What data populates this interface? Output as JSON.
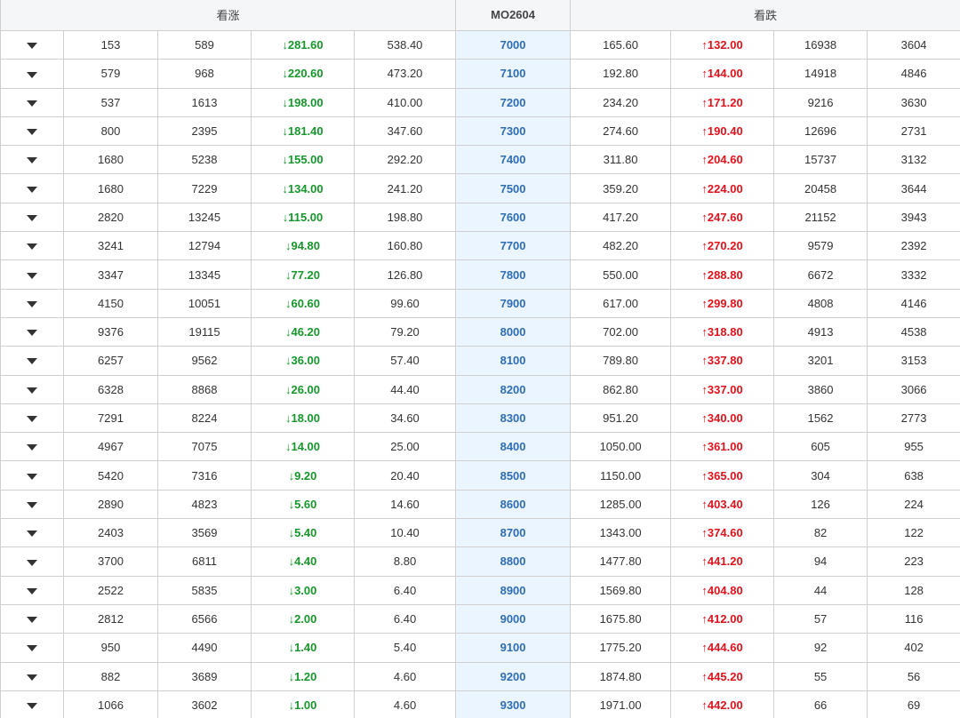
{
  "header": {
    "call_label": "看涨",
    "contract": "MO2604",
    "put_label": "看跌"
  },
  "colors": {
    "down": "#17962b",
    "up": "#e0121b",
    "strike": "#2e6db4",
    "strike_bg": "#ebf5ff"
  },
  "icons": {
    "expand": "caret-down-icon"
  },
  "rows": [
    {
      "call_oi": "153",
      "call_vol": "589",
      "call_chg": "↓281.60",
      "call_price": "538.40",
      "strike": "7000",
      "put_price": "165.60",
      "put_chg": "↑132.00",
      "put_vol": "16938",
      "put_oi": "3604"
    },
    {
      "call_oi": "579",
      "call_vol": "968",
      "call_chg": "↓220.60",
      "call_price": "473.20",
      "strike": "7100",
      "put_price": "192.80",
      "put_chg": "↑144.00",
      "put_vol": "14918",
      "put_oi": "4846"
    },
    {
      "call_oi": "537",
      "call_vol": "1613",
      "call_chg": "↓198.00",
      "call_price": "410.00",
      "strike": "7200",
      "put_price": "234.20",
      "put_chg": "↑171.20",
      "put_vol": "9216",
      "put_oi": "3630"
    },
    {
      "call_oi": "800",
      "call_vol": "2395",
      "call_chg": "↓181.40",
      "call_price": "347.60",
      "strike": "7300",
      "put_price": "274.60",
      "put_chg": "↑190.40",
      "put_vol": "12696",
      "put_oi": "2731"
    },
    {
      "call_oi": "1680",
      "call_vol": "5238",
      "call_chg": "↓155.00",
      "call_price": "292.20",
      "strike": "7400",
      "put_price": "311.80",
      "put_chg": "↑204.60",
      "put_vol": "15737",
      "put_oi": "3132"
    },
    {
      "call_oi": "1680",
      "call_vol": "7229",
      "call_chg": "↓134.00",
      "call_price": "241.20",
      "strike": "7500",
      "put_price": "359.20",
      "put_chg": "↑224.00",
      "put_vol": "20458",
      "put_oi": "3644"
    },
    {
      "call_oi": "2820",
      "call_vol": "13245",
      "call_chg": "↓115.00",
      "call_price": "198.80",
      "strike": "7600",
      "put_price": "417.20",
      "put_chg": "↑247.60",
      "put_vol": "21152",
      "put_oi": "3943"
    },
    {
      "call_oi": "3241",
      "call_vol": "12794",
      "call_chg": "↓94.80",
      "call_price": "160.80",
      "strike": "7700",
      "put_price": "482.20",
      "put_chg": "↑270.20",
      "put_vol": "9579",
      "put_oi": "2392"
    },
    {
      "call_oi": "3347",
      "call_vol": "13345",
      "call_chg": "↓77.20",
      "call_price": "126.80",
      "strike": "7800",
      "put_price": "550.00",
      "put_chg": "↑288.80",
      "put_vol": "6672",
      "put_oi": "3332"
    },
    {
      "call_oi": "4150",
      "call_vol": "10051",
      "call_chg": "↓60.60",
      "call_price": "99.60",
      "strike": "7900",
      "put_price": "617.00",
      "put_chg": "↑299.80",
      "put_vol": "4808",
      "put_oi": "4146"
    },
    {
      "call_oi": "9376",
      "call_vol": "19115",
      "call_chg": "↓46.20",
      "call_price": "79.20",
      "strike": "8000",
      "put_price": "702.00",
      "put_chg": "↑318.80",
      "put_vol": "4913",
      "put_oi": "4538"
    },
    {
      "call_oi": "6257",
      "call_vol": "9562",
      "call_chg": "↓36.00",
      "call_price": "57.40",
      "strike": "8100",
      "put_price": "789.80",
      "put_chg": "↑337.80",
      "put_vol": "3201",
      "put_oi": "3153"
    },
    {
      "call_oi": "6328",
      "call_vol": "8868",
      "call_chg": "↓26.00",
      "call_price": "44.40",
      "strike": "8200",
      "put_price": "862.80",
      "put_chg": "↑337.00",
      "put_vol": "3860",
      "put_oi": "3066"
    },
    {
      "call_oi": "7291",
      "call_vol": "8224",
      "call_chg": "↓18.00",
      "call_price": "34.60",
      "strike": "8300",
      "put_price": "951.20",
      "put_chg": "↑340.00",
      "put_vol": "1562",
      "put_oi": "2773"
    },
    {
      "call_oi": "4967",
      "call_vol": "7075",
      "call_chg": "↓14.00",
      "call_price": "25.00",
      "strike": "8400",
      "put_price": "1050.00",
      "put_chg": "↑361.00",
      "put_vol": "605",
      "put_oi": "955"
    },
    {
      "call_oi": "5420",
      "call_vol": "7316",
      "call_chg": "↓9.20",
      "call_price": "20.40",
      "strike": "8500",
      "put_price": "1150.00",
      "put_chg": "↑365.00",
      "put_vol": "304",
      "put_oi": "638"
    },
    {
      "call_oi": "2890",
      "call_vol": "4823",
      "call_chg": "↓5.60",
      "call_price": "14.60",
      "strike": "8600",
      "put_price": "1285.00",
      "put_chg": "↑403.40",
      "put_vol": "126",
      "put_oi": "224"
    },
    {
      "call_oi": "2403",
      "call_vol": "3569",
      "call_chg": "↓5.40",
      "call_price": "10.40",
      "strike": "8700",
      "put_price": "1343.00",
      "put_chg": "↑374.60",
      "put_vol": "82",
      "put_oi": "122"
    },
    {
      "call_oi": "3700",
      "call_vol": "6811",
      "call_chg": "↓4.40",
      "call_price": "8.80",
      "strike": "8800",
      "put_price": "1477.80",
      "put_chg": "↑441.20",
      "put_vol": "94",
      "put_oi": "223"
    },
    {
      "call_oi": "2522",
      "call_vol": "5835",
      "call_chg": "↓3.00",
      "call_price": "6.40",
      "strike": "8900",
      "put_price": "1569.80",
      "put_chg": "↑404.80",
      "put_vol": "44",
      "put_oi": "128"
    },
    {
      "call_oi": "2812",
      "call_vol": "6566",
      "call_chg": "↓2.00",
      "call_price": "6.40",
      "strike": "9000",
      "put_price": "1675.80",
      "put_chg": "↑412.00",
      "put_vol": "57",
      "put_oi": "116"
    },
    {
      "call_oi": "950",
      "call_vol": "4490",
      "call_chg": "↓1.40",
      "call_price": "5.40",
      "strike": "9100",
      "put_price": "1775.20",
      "put_chg": "↑444.60",
      "put_vol": "92",
      "put_oi": "402"
    },
    {
      "call_oi": "882",
      "call_vol": "3689",
      "call_chg": "↓1.20",
      "call_price": "4.60",
      "strike": "9200",
      "put_price": "1874.80",
      "put_chg": "↑445.20",
      "put_vol": "55",
      "put_oi": "56"
    },
    {
      "call_oi": "1066",
      "call_vol": "3602",
      "call_chg": "↓1.00",
      "call_price": "4.60",
      "strike": "9300",
      "put_price": "1971.00",
      "put_chg": "↑442.00",
      "put_vol": "66",
      "put_oi": "69"
    }
  ]
}
